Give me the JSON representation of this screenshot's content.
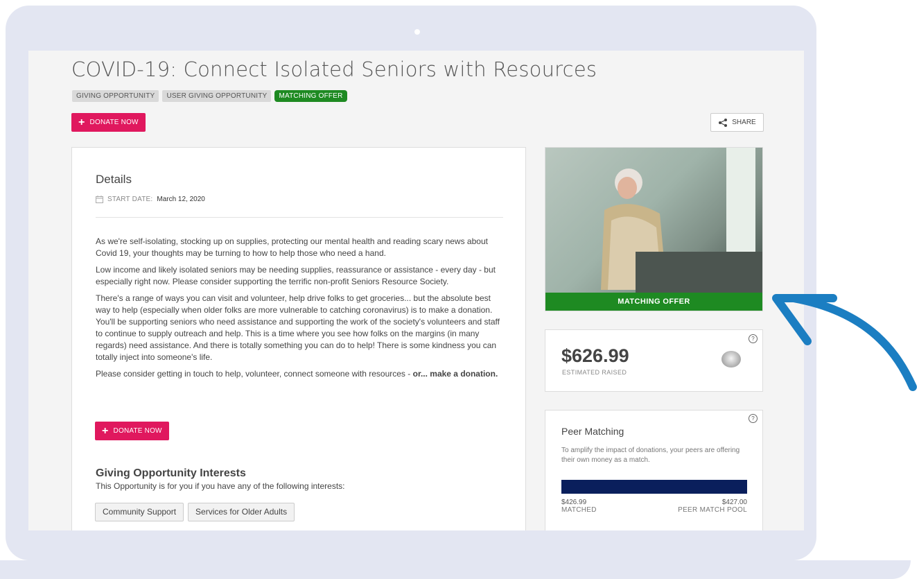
{
  "page": {
    "title": "COVID-19: Connect Isolated Seniors with Resources",
    "tags": [
      {
        "label": "GIVING OPPORTUNITY"
      },
      {
        "label": "USER GIVING OPPORTUNITY"
      },
      {
        "label": "MATCHING OFFER",
        "color": "#1e8a22"
      }
    ],
    "donate_label": "DONATE NOW",
    "share_label": "SHARE"
  },
  "details": {
    "heading": "Details",
    "start_label": "START DATE:",
    "start_value": "March 12, 2020",
    "paragraphs": [
      "As we're self-isolating, stocking up on supplies, protecting our mental health and reading scary news about Covid 19, your thoughts may be turning to how to help those who need a hand.",
      "Low income and likely isolated seniors may be needing supplies, reassurance or assistance - every day - but especially right now. Please consider supporting the terrific non-profit Seniors Resource Society.",
      "There's a range of ways you can visit and volunteer, help drive folks to get groceries... but the absolute best way to help (especially when older folks are more vulnerable to catching coronavirus) is to make a donation. You'll be supporting seniors who need assistance and supporting the work of the society's volunteers and staff to continue to supply outreach and help. This is a time where you see how folks on the margins (in many regards) need assistance. And there is totally something you can do to help! There is some kindness you can totally inject into someone's life.",
      "Please consider getting in touch to help, volunteer, connect someone with resources - "
    ],
    "paragraph_bold": "or... make a donation."
  },
  "interests": {
    "heading": "Giving Opportunity Interests",
    "subtitle": "This Opportunity is for you if you have any of the following interests:",
    "chips": [
      "Community Support",
      "Services for Older Adults"
    ]
  },
  "sidebar": {
    "image_banner": "MATCHING OFFER",
    "raised_amount": "$626.99",
    "raised_label": "ESTIMATED RAISED",
    "help_glyph": "?",
    "peer": {
      "heading": "Peer Matching",
      "description": "To amplify the impact of donations, your peers are offering their own money as a match.",
      "matched_value": "$426.99",
      "matched_label": "MATCHED",
      "pool_value": "$427.00",
      "pool_label": "PEER MATCH POOL",
      "progress_fraction": 0.9999
    }
  },
  "colors": {
    "accent_donate": "#e0185e",
    "matching_green": "#1e8a22",
    "progress_navy": "#0a1f5c",
    "arrow_blue": "#1b7ec2",
    "laptop_frame": "#e3e6f2"
  }
}
